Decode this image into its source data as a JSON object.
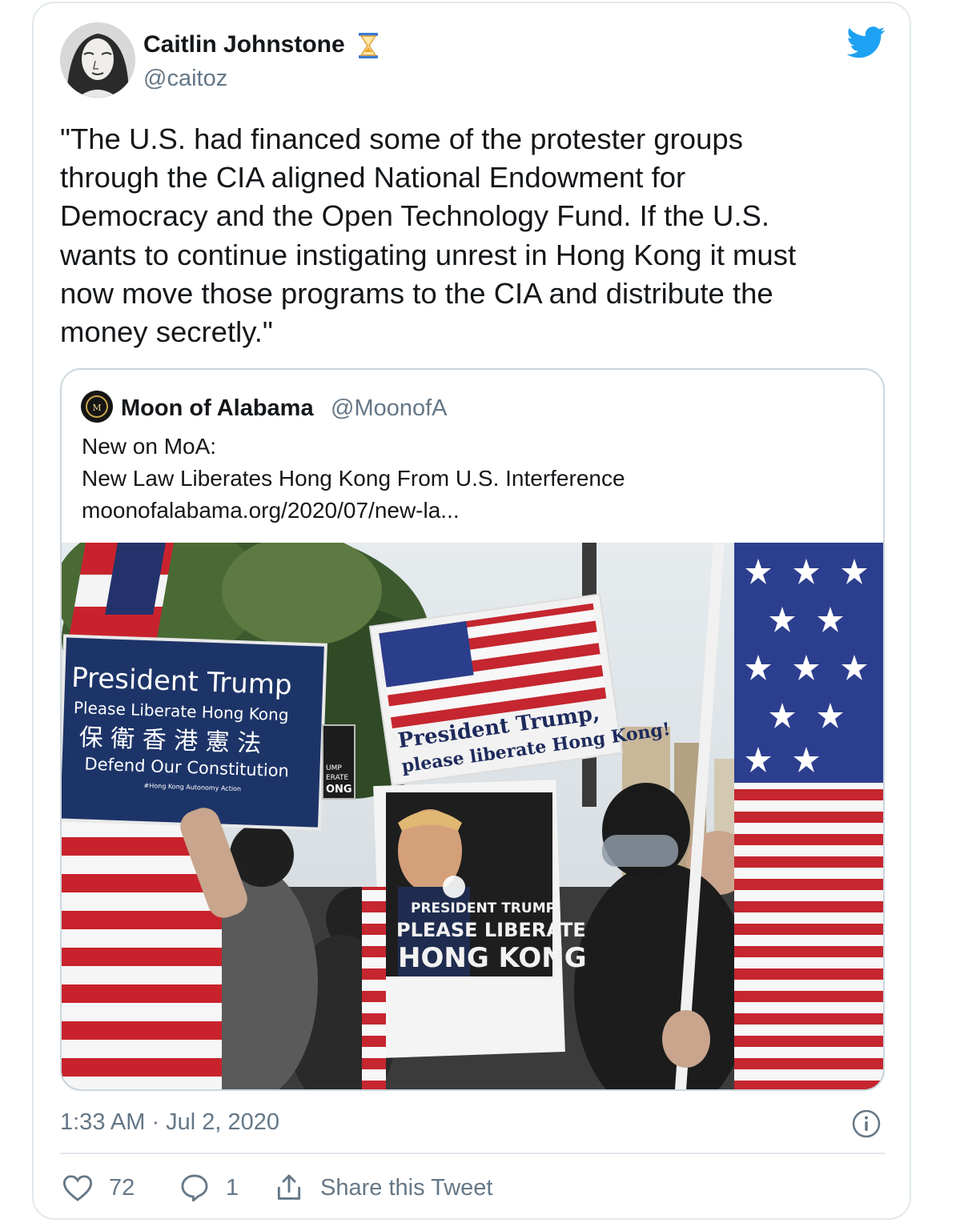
{
  "tweet": {
    "author": {
      "name": "Caitlin Johnstone",
      "handle": "@caitoz",
      "avatar_icon": "user-avatar",
      "badge_icon": "hourglass-icon"
    },
    "brand_icon": "twitter-bird-icon",
    "text": "\"The U.S. had financed some of the protester groups\nthrough the CIA aligned National Endowment for\nDemocracy and the Open Technology Fund. If the U.S.\nwants to continue instigating unrest in Hong Kong it must\nnow move those programs to the CIA and distribute the\nmoney secretly.\"",
    "timestamp": "1:33 AM · Jul 2, 2020"
  },
  "quoted_tweet": {
    "author": {
      "name": "Moon of Alabama",
      "handle": "@MoonofA",
      "avatar_icon": "moon-of-alabama-logo"
    },
    "text": "New on MoA:\nNew Law Liberates Hong Kong From U.S. Interference\nmoonofalabama.org/2020/07/new-la...",
    "photo": {
      "sign_left": {
        "line1": "President Trump",
        "line2": "Please Liberate Hong Kong",
        "line3": "保 衛 香 港 憲 法",
        "line4": "Defend Our Constitution",
        "line5": "#Hong Kong Autonomy Action"
      },
      "sign_small": [
        "UMP",
        "ERATE",
        "ONG"
      ],
      "sign_flag": {
        "line1": "President Trump,",
        "line2": "please liberate Hong Kong!"
      },
      "sign_poster": {
        "line1": "PRESIDENT TRUMP",
        "line2": "PLEASE LIBERATE",
        "line3": "HONG KONG"
      }
    }
  },
  "actions": {
    "likes": "72",
    "replies": "1",
    "share_label": "Share this Tweet"
  },
  "colors": {
    "twitter_blue": "#1da1f2",
    "secondary_text": "#657786",
    "border": "#e1e8ed"
  }
}
